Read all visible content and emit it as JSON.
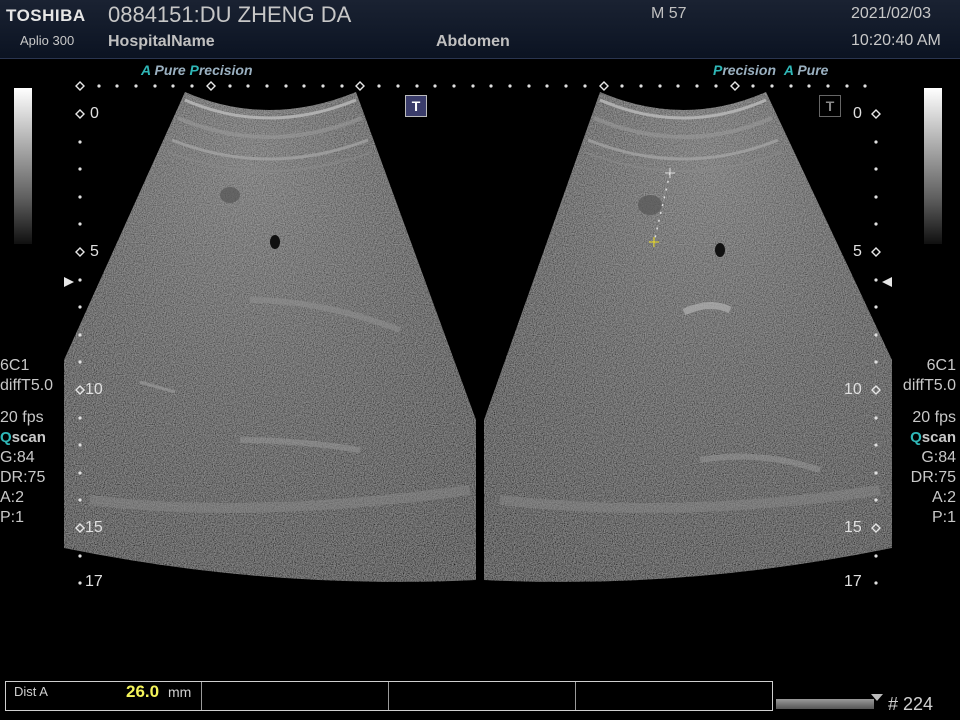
{
  "header": {
    "brand": "TOSHIBA",
    "model": "Aplio 300",
    "patient": "0884151:DU ZHENG DA",
    "hospital": "HospitalName",
    "exam": "Abdomen",
    "sex_age": "M 57",
    "date": "2021/02/03",
    "time": "10:20:40 AM"
  },
  "left_panel": {
    "processing": {
      "a": "A",
      "pure": "Pure",
      "p": "P",
      "precision": "recision"
    },
    "depth_labels": [
      "0",
      "5",
      "10",
      "15",
      "17"
    ],
    "probe": "6C1",
    "preset": "diffT5.0",
    "fps": "20 fps",
    "scan_q": "Q",
    "scan": "scan",
    "gain": "G:84",
    "dr": "DR:75",
    "a_val": "A:2",
    "p_val": "P:1"
  },
  "right_panel": {
    "processing": {
      "p": "P",
      "precision": "recision",
      "a": "A",
      "pure": "Pure"
    },
    "depth_labels": [
      "0",
      "5",
      "10",
      "15",
      "17"
    ],
    "probe": "6C1",
    "preset": "diffT5.0",
    "fps": "20 fps",
    "scan_q": "Q",
    "scan": "scan",
    "gain": "G:84",
    "dr": "DR:75",
    "a_val": "A:2",
    "p_val": "P:1"
  },
  "markers": {
    "t": "T"
  },
  "measurement": {
    "label": "Dist A",
    "value": "26.0",
    "unit": "mm"
  },
  "frame_number": "# 224",
  "colors": {
    "accent": "#2fb7b7",
    "measure_value": "#f4f45a",
    "caliper": "#f0e020"
  }
}
